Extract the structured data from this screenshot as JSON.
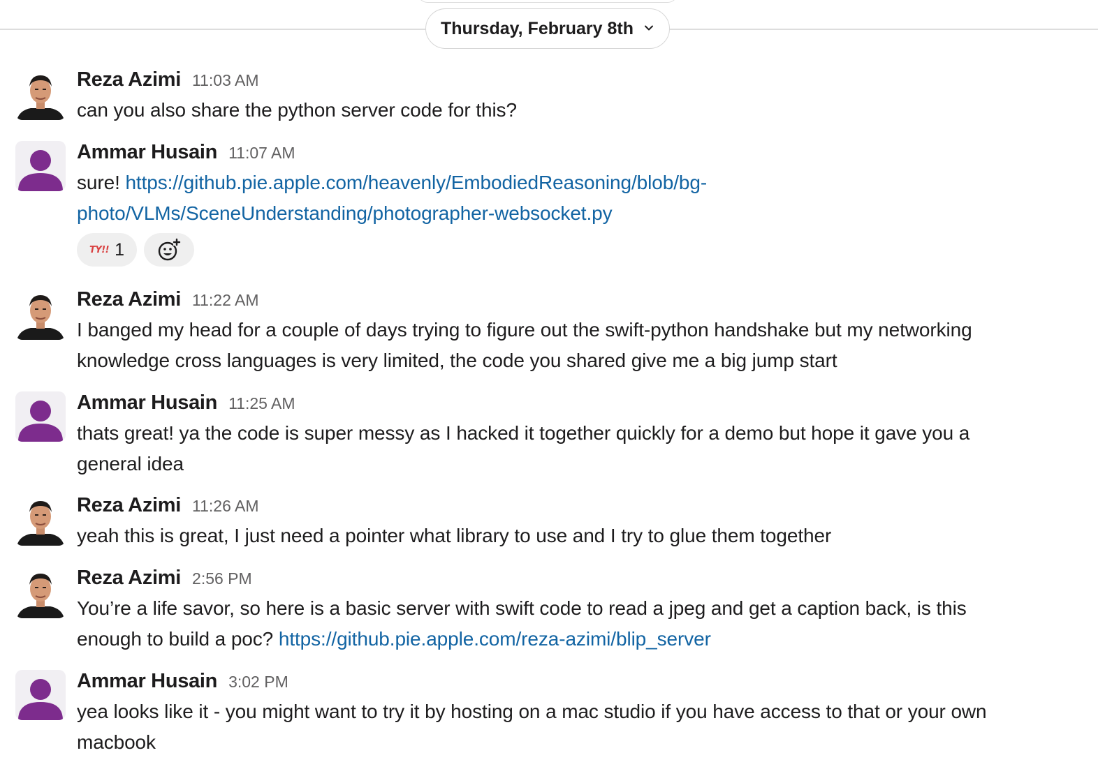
{
  "divider": {
    "date_label": "Thursday, February 8th",
    "chevron_icon": "chevron-down-icon"
  },
  "colors": {
    "link": "#1264a3",
    "default_avatar": "#7d2c8d",
    "reaction_bg": "#efefef"
  },
  "messages": [
    {
      "author": "Reza Azimi",
      "time": "11:03 AM",
      "text": "can you also share the python server code for this?"
    },
    {
      "author": "Ammar Husain",
      "time": "11:07 AM",
      "text_prefix": "sure! ",
      "link": "https://github.pie.apple.com/heavenly/EmbodiedReasoning/blob/bg-photo/VLMs/SceneUnderstanding/photographer-websocket.py",
      "link_line1": "https://github.pie.apple.com/heavenly/EmbodiedReasoning/blob/bg-",
      "link_line2": "photo/VLMs/SceneUnderstanding/photographer-websocket.py",
      "reactions": [
        {
          "emoji_text": "TY!!",
          "count": "1"
        }
      ],
      "add_reaction_icon": "add-emoji-icon"
    },
    {
      "author": "Reza Azimi",
      "time": "11:22 AM",
      "text_line1": "I banged my head for a couple of days trying to figure out the swift-python handshake but my networking",
      "text_line2": "knowledge cross languages is very limited, the code you shared give me a big jump start"
    },
    {
      "author": "Ammar Husain",
      "time": "11:25 AM",
      "text_line1": "thats great! ya the code is super messy as I hacked it together quickly for a demo but hope it gave you a",
      "text_line2": "general idea"
    },
    {
      "author": "Reza Azimi",
      "time": "11:26 AM",
      "text": "yeah this is great, I just need a pointer what library to use and I try to glue them together"
    },
    {
      "author": "Reza Azimi",
      "time": "2:56 PM",
      "text_line1": "You’re a life savor, so here is a basic server with swift code to read a jpeg and get a caption back, is this",
      "text_line2_prefix": "enough to build a poc? ",
      "link": "https://github.pie.apple.com/reza-azimi/blip_server"
    },
    {
      "author": "Ammar Husain",
      "time": "3:02 PM",
      "text_line1": "yea looks like it -  you might want to try it by hosting on a mac studio if you have access to that or your own",
      "text_line2": "macbook"
    }
  ]
}
